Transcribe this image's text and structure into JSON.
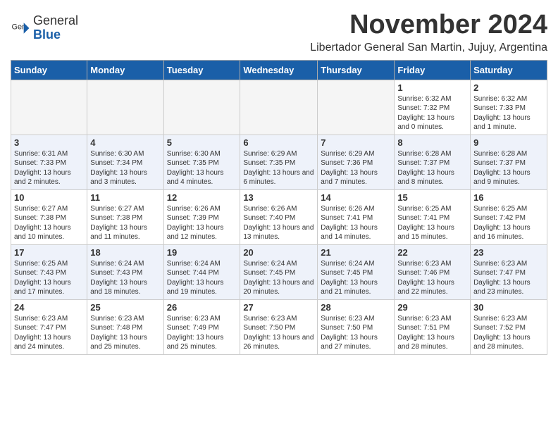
{
  "header": {
    "logo": {
      "general": "General",
      "blue": "Blue"
    },
    "title": "November 2024",
    "location": "Libertador General San Martin, Jujuy, Argentina"
  },
  "weekdays": [
    "Sunday",
    "Monday",
    "Tuesday",
    "Wednesday",
    "Thursday",
    "Friday",
    "Saturday"
  ],
  "weeks": [
    [
      {
        "day": "",
        "info": ""
      },
      {
        "day": "",
        "info": ""
      },
      {
        "day": "",
        "info": ""
      },
      {
        "day": "",
        "info": ""
      },
      {
        "day": "",
        "info": ""
      },
      {
        "day": "1",
        "info": "Sunrise: 6:32 AM\nSunset: 7:32 PM\nDaylight: 13 hours and 0 minutes."
      },
      {
        "day": "2",
        "info": "Sunrise: 6:32 AM\nSunset: 7:33 PM\nDaylight: 13 hours and 1 minute."
      }
    ],
    [
      {
        "day": "3",
        "info": "Sunrise: 6:31 AM\nSunset: 7:33 PM\nDaylight: 13 hours and 2 minutes."
      },
      {
        "day": "4",
        "info": "Sunrise: 6:30 AM\nSunset: 7:34 PM\nDaylight: 13 hours and 3 minutes."
      },
      {
        "day": "5",
        "info": "Sunrise: 6:30 AM\nSunset: 7:35 PM\nDaylight: 13 hours and 4 minutes."
      },
      {
        "day": "6",
        "info": "Sunrise: 6:29 AM\nSunset: 7:35 PM\nDaylight: 13 hours and 6 minutes."
      },
      {
        "day": "7",
        "info": "Sunrise: 6:29 AM\nSunset: 7:36 PM\nDaylight: 13 hours and 7 minutes."
      },
      {
        "day": "8",
        "info": "Sunrise: 6:28 AM\nSunset: 7:37 PM\nDaylight: 13 hours and 8 minutes."
      },
      {
        "day": "9",
        "info": "Sunrise: 6:28 AM\nSunset: 7:37 PM\nDaylight: 13 hours and 9 minutes."
      }
    ],
    [
      {
        "day": "10",
        "info": "Sunrise: 6:27 AM\nSunset: 7:38 PM\nDaylight: 13 hours and 10 minutes."
      },
      {
        "day": "11",
        "info": "Sunrise: 6:27 AM\nSunset: 7:38 PM\nDaylight: 13 hours and 11 minutes."
      },
      {
        "day": "12",
        "info": "Sunrise: 6:26 AM\nSunset: 7:39 PM\nDaylight: 13 hours and 12 minutes."
      },
      {
        "day": "13",
        "info": "Sunrise: 6:26 AM\nSunset: 7:40 PM\nDaylight: 13 hours and 13 minutes."
      },
      {
        "day": "14",
        "info": "Sunrise: 6:26 AM\nSunset: 7:41 PM\nDaylight: 13 hours and 14 minutes."
      },
      {
        "day": "15",
        "info": "Sunrise: 6:25 AM\nSunset: 7:41 PM\nDaylight: 13 hours and 15 minutes."
      },
      {
        "day": "16",
        "info": "Sunrise: 6:25 AM\nSunset: 7:42 PM\nDaylight: 13 hours and 16 minutes."
      }
    ],
    [
      {
        "day": "17",
        "info": "Sunrise: 6:25 AM\nSunset: 7:43 PM\nDaylight: 13 hours and 17 minutes."
      },
      {
        "day": "18",
        "info": "Sunrise: 6:24 AM\nSunset: 7:43 PM\nDaylight: 13 hours and 18 minutes."
      },
      {
        "day": "19",
        "info": "Sunrise: 6:24 AM\nSunset: 7:44 PM\nDaylight: 13 hours and 19 minutes."
      },
      {
        "day": "20",
        "info": "Sunrise: 6:24 AM\nSunset: 7:45 PM\nDaylight: 13 hours and 20 minutes."
      },
      {
        "day": "21",
        "info": "Sunrise: 6:24 AM\nSunset: 7:45 PM\nDaylight: 13 hours and 21 minutes."
      },
      {
        "day": "22",
        "info": "Sunrise: 6:23 AM\nSunset: 7:46 PM\nDaylight: 13 hours and 22 minutes."
      },
      {
        "day": "23",
        "info": "Sunrise: 6:23 AM\nSunset: 7:47 PM\nDaylight: 13 hours and 23 minutes."
      }
    ],
    [
      {
        "day": "24",
        "info": "Sunrise: 6:23 AM\nSunset: 7:47 PM\nDaylight: 13 hours and 24 minutes."
      },
      {
        "day": "25",
        "info": "Sunrise: 6:23 AM\nSunset: 7:48 PM\nDaylight: 13 hours and 25 minutes."
      },
      {
        "day": "26",
        "info": "Sunrise: 6:23 AM\nSunset: 7:49 PM\nDaylight: 13 hours and 25 minutes."
      },
      {
        "day": "27",
        "info": "Sunrise: 6:23 AM\nSunset: 7:50 PM\nDaylight: 13 hours and 26 minutes."
      },
      {
        "day": "28",
        "info": "Sunrise: 6:23 AM\nSunset: 7:50 PM\nDaylight: 13 hours and 27 minutes."
      },
      {
        "day": "29",
        "info": "Sunrise: 6:23 AM\nSunset: 7:51 PM\nDaylight: 13 hours and 28 minutes."
      },
      {
        "day": "30",
        "info": "Sunrise: 6:23 AM\nSunset: 7:52 PM\nDaylight: 13 hours and 28 minutes."
      }
    ]
  ]
}
